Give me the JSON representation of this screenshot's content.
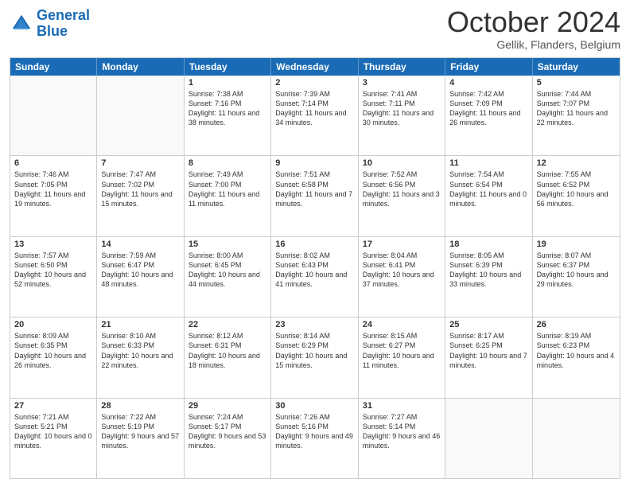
{
  "header": {
    "logo_general": "General",
    "logo_blue": "Blue",
    "month_title": "October 2024",
    "location": "Gellik, Flanders, Belgium"
  },
  "weekdays": [
    "Sunday",
    "Monday",
    "Tuesday",
    "Wednesday",
    "Thursday",
    "Friday",
    "Saturday"
  ],
  "weeks": [
    [
      {
        "day": "",
        "sunrise": "",
        "sunset": "",
        "daylight": ""
      },
      {
        "day": "",
        "sunrise": "",
        "sunset": "",
        "daylight": ""
      },
      {
        "day": "1",
        "sunrise": "Sunrise: 7:38 AM",
        "sunset": "Sunset: 7:16 PM",
        "daylight": "Daylight: 11 hours and 38 minutes."
      },
      {
        "day": "2",
        "sunrise": "Sunrise: 7:39 AM",
        "sunset": "Sunset: 7:14 PM",
        "daylight": "Daylight: 11 hours and 34 minutes."
      },
      {
        "day": "3",
        "sunrise": "Sunrise: 7:41 AM",
        "sunset": "Sunset: 7:11 PM",
        "daylight": "Daylight: 11 hours and 30 minutes."
      },
      {
        "day": "4",
        "sunrise": "Sunrise: 7:42 AM",
        "sunset": "Sunset: 7:09 PM",
        "daylight": "Daylight: 11 hours and 26 minutes."
      },
      {
        "day": "5",
        "sunrise": "Sunrise: 7:44 AM",
        "sunset": "Sunset: 7:07 PM",
        "daylight": "Daylight: 11 hours and 22 minutes."
      }
    ],
    [
      {
        "day": "6",
        "sunrise": "Sunrise: 7:46 AM",
        "sunset": "Sunset: 7:05 PM",
        "daylight": "Daylight: 11 hours and 19 minutes."
      },
      {
        "day": "7",
        "sunrise": "Sunrise: 7:47 AM",
        "sunset": "Sunset: 7:02 PM",
        "daylight": "Daylight: 11 hours and 15 minutes."
      },
      {
        "day": "8",
        "sunrise": "Sunrise: 7:49 AM",
        "sunset": "Sunset: 7:00 PM",
        "daylight": "Daylight: 11 hours and 11 minutes."
      },
      {
        "day": "9",
        "sunrise": "Sunrise: 7:51 AM",
        "sunset": "Sunset: 6:58 PM",
        "daylight": "Daylight: 11 hours and 7 minutes."
      },
      {
        "day": "10",
        "sunrise": "Sunrise: 7:52 AM",
        "sunset": "Sunset: 6:56 PM",
        "daylight": "Daylight: 11 hours and 3 minutes."
      },
      {
        "day": "11",
        "sunrise": "Sunrise: 7:54 AM",
        "sunset": "Sunset: 6:54 PM",
        "daylight": "Daylight: 11 hours and 0 minutes."
      },
      {
        "day": "12",
        "sunrise": "Sunrise: 7:55 AM",
        "sunset": "Sunset: 6:52 PM",
        "daylight": "Daylight: 10 hours and 56 minutes."
      }
    ],
    [
      {
        "day": "13",
        "sunrise": "Sunrise: 7:57 AM",
        "sunset": "Sunset: 6:50 PM",
        "daylight": "Daylight: 10 hours and 52 minutes."
      },
      {
        "day": "14",
        "sunrise": "Sunrise: 7:59 AM",
        "sunset": "Sunset: 6:47 PM",
        "daylight": "Daylight: 10 hours and 48 minutes."
      },
      {
        "day": "15",
        "sunrise": "Sunrise: 8:00 AM",
        "sunset": "Sunset: 6:45 PM",
        "daylight": "Daylight: 10 hours and 44 minutes."
      },
      {
        "day": "16",
        "sunrise": "Sunrise: 8:02 AM",
        "sunset": "Sunset: 6:43 PM",
        "daylight": "Daylight: 10 hours and 41 minutes."
      },
      {
        "day": "17",
        "sunrise": "Sunrise: 8:04 AM",
        "sunset": "Sunset: 6:41 PM",
        "daylight": "Daylight: 10 hours and 37 minutes."
      },
      {
        "day": "18",
        "sunrise": "Sunrise: 8:05 AM",
        "sunset": "Sunset: 6:39 PM",
        "daylight": "Daylight: 10 hours and 33 minutes."
      },
      {
        "day": "19",
        "sunrise": "Sunrise: 8:07 AM",
        "sunset": "Sunset: 6:37 PM",
        "daylight": "Daylight: 10 hours and 29 minutes."
      }
    ],
    [
      {
        "day": "20",
        "sunrise": "Sunrise: 8:09 AM",
        "sunset": "Sunset: 6:35 PM",
        "daylight": "Daylight: 10 hours and 26 minutes."
      },
      {
        "day": "21",
        "sunrise": "Sunrise: 8:10 AM",
        "sunset": "Sunset: 6:33 PM",
        "daylight": "Daylight: 10 hours and 22 minutes."
      },
      {
        "day": "22",
        "sunrise": "Sunrise: 8:12 AM",
        "sunset": "Sunset: 6:31 PM",
        "daylight": "Daylight: 10 hours and 18 minutes."
      },
      {
        "day": "23",
        "sunrise": "Sunrise: 8:14 AM",
        "sunset": "Sunset: 6:29 PM",
        "daylight": "Daylight: 10 hours and 15 minutes."
      },
      {
        "day": "24",
        "sunrise": "Sunrise: 8:15 AM",
        "sunset": "Sunset: 6:27 PM",
        "daylight": "Daylight: 10 hours and 11 minutes."
      },
      {
        "day": "25",
        "sunrise": "Sunrise: 8:17 AM",
        "sunset": "Sunset: 6:25 PM",
        "daylight": "Daylight: 10 hours and 7 minutes."
      },
      {
        "day": "26",
        "sunrise": "Sunrise: 8:19 AM",
        "sunset": "Sunset: 6:23 PM",
        "daylight": "Daylight: 10 hours and 4 minutes."
      }
    ],
    [
      {
        "day": "27",
        "sunrise": "Sunrise: 7:21 AM",
        "sunset": "Sunset: 5:21 PM",
        "daylight": "Daylight: 10 hours and 0 minutes."
      },
      {
        "day": "28",
        "sunrise": "Sunrise: 7:22 AM",
        "sunset": "Sunset: 5:19 PM",
        "daylight": "Daylight: 9 hours and 57 minutes."
      },
      {
        "day": "29",
        "sunrise": "Sunrise: 7:24 AM",
        "sunset": "Sunset: 5:17 PM",
        "daylight": "Daylight: 9 hours and 53 minutes."
      },
      {
        "day": "30",
        "sunrise": "Sunrise: 7:26 AM",
        "sunset": "Sunset: 5:16 PM",
        "daylight": "Daylight: 9 hours and 49 minutes."
      },
      {
        "day": "31",
        "sunrise": "Sunrise: 7:27 AM",
        "sunset": "Sunset: 5:14 PM",
        "daylight": "Daylight: 9 hours and 46 minutes."
      },
      {
        "day": "",
        "sunrise": "",
        "sunset": "",
        "daylight": ""
      },
      {
        "day": "",
        "sunrise": "",
        "sunset": "",
        "daylight": ""
      }
    ]
  ]
}
